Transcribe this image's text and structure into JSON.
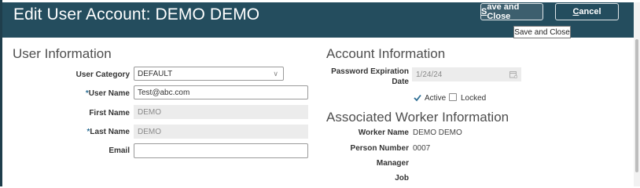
{
  "header": {
    "title": "Edit User Account: DEMO DEMO",
    "save_close_prefix": "S",
    "save_close_rest": "ave and Close",
    "cancel_prefix": "C",
    "cancel_rest": "ancel",
    "tooltip": "Save and Close"
  },
  "user_info": {
    "title": "User Information",
    "user_category_label": "User Category",
    "user_category_value": "DEFAULT",
    "user_name_label": "User Name",
    "user_name_value": "Test@abc.com",
    "first_name_label": "First Name",
    "first_name_value": "DEMO",
    "last_name_label": "Last Name",
    "last_name_value": "DEMO",
    "email_label": "Email",
    "email_value": "",
    "required_mark": "*"
  },
  "account_info": {
    "title": "Account Information",
    "password_expiration_label_1": "Password Expiration",
    "password_expiration_label_2": "Date",
    "password_expiration_value": "1/24/24",
    "active_label": "Active",
    "active_checked": true,
    "locked_label": "Locked",
    "locked_checked": false
  },
  "worker_info": {
    "title": "Associated Worker Information",
    "worker_name_label": "Worker Name",
    "worker_name_value": "DEMO DEMO",
    "person_number_label": "Person Number",
    "person_number_value": "0007",
    "manager_label": "Manager",
    "manager_value": "",
    "job_label": "Job",
    "job_value": ""
  },
  "colors": {
    "header_bg": "#244d5e",
    "accent_check": "#2d6e94"
  },
  "icons": {
    "dropdown": "chevron-down-icon",
    "date": "calendar-icon",
    "check": "checkmark-icon"
  }
}
